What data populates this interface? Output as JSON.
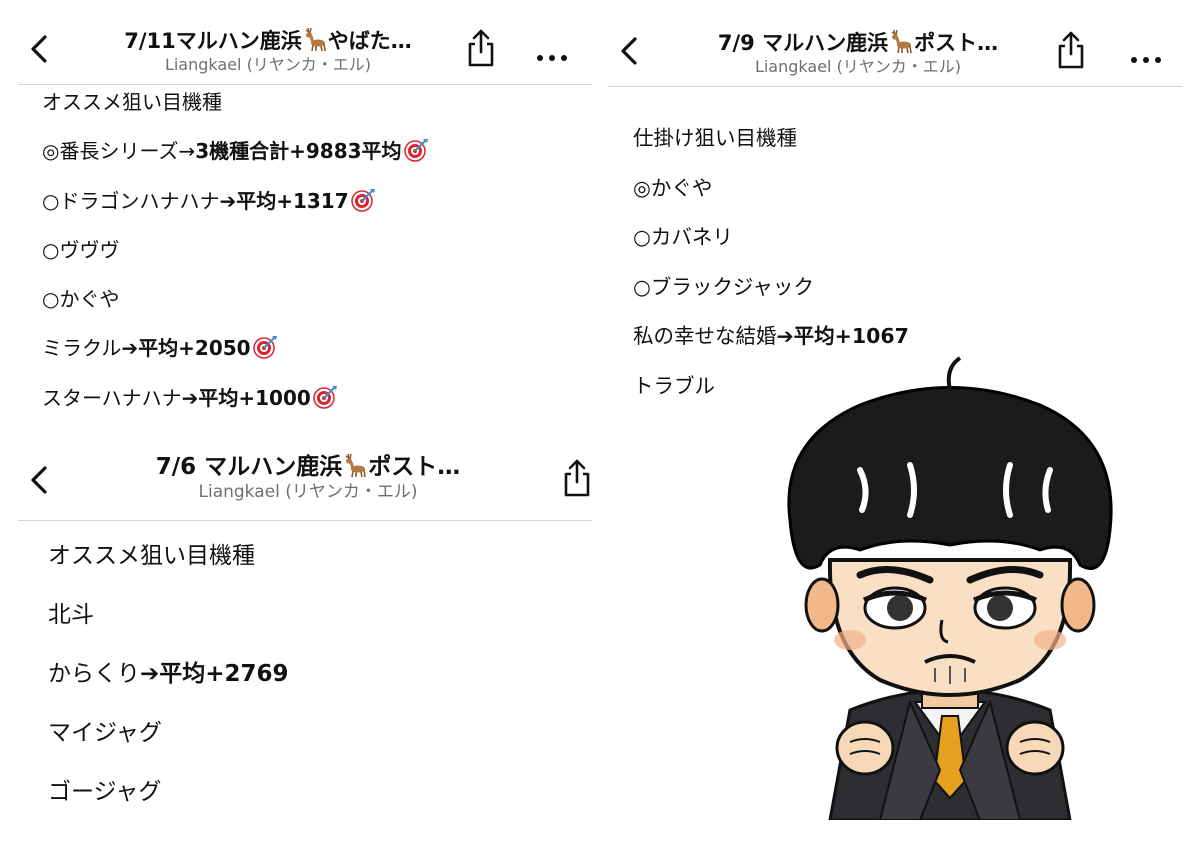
{
  "screen_1": {
    "title": "7/11マルハン鹿浜",
    "title_suffix": "やばた…",
    "deer_icon": "deer-emoji",
    "author": "Liangkael (リヤンカ・エル)",
    "items": [
      {
        "text": "オススメ狙い目機種",
        "emph": "",
        "target": false
      },
      {
        "text": "◎番長シリーズ→",
        "emph": "3機種合計+9883平均",
        "target": true
      },
      {
        "text": "○ドラゴンハナハナ",
        "emph": "➔平均+1317",
        "target": true
      },
      {
        "text": "○ヴヴヴ",
        "emph": "",
        "target": false
      },
      {
        "text": "○かぐや",
        "emph": "",
        "target": false
      },
      {
        "text": "ミラクル",
        "emph": "➔平均+2050",
        "target": true
      },
      {
        "text": "スターハナハナ",
        "emph": "➔平均+1000",
        "target": true
      }
    ]
  },
  "screen_2": {
    "title": "7/6 マルハン鹿浜",
    "title_suffix": "ポスト…",
    "deer_icon": "deer-emoji",
    "author": "Liangkael (リヤンカ・エル)",
    "items": [
      {
        "text": "オススメ狙い目機種",
        "emph": ""
      },
      {
        "text": "北斗",
        "emph": ""
      },
      {
        "text": "からくり",
        "emph": "➔平均+2769"
      },
      {
        "text": "マイジャグ",
        "emph": ""
      },
      {
        "text": "ゴージャグ",
        "emph": ""
      }
    ]
  },
  "screen_3": {
    "title": "7/9 マルハン鹿浜",
    "title_suffix": "ポスト…",
    "deer_icon": "deer-emoji",
    "author": "Liangkael (リヤンカ・エル)",
    "items": [
      {
        "text": "仕掛け狙い目機種",
        "emph": ""
      },
      {
        "text": "◎かぐや",
        "emph": ""
      },
      {
        "text": "○カバネリ",
        "emph": ""
      },
      {
        "text": "○ブラックジャック",
        "emph": ""
      },
      {
        "text": "私の幸せな結婚",
        "emph": "➔平均+1067"
      },
      {
        "text": "トラブル",
        "emph": ""
      }
    ]
  },
  "icons": {
    "back": "chevron-left-icon",
    "share": "share-icon",
    "more": "more-horizontal-icon",
    "target": "direct-hit-emoji",
    "illustration": "cartoon-man-in-suit"
  },
  "colors": {
    "text": "#111111",
    "subtext": "#6f6f6f",
    "divider": "#d2d2d2",
    "target_red": "#d9262e"
  }
}
